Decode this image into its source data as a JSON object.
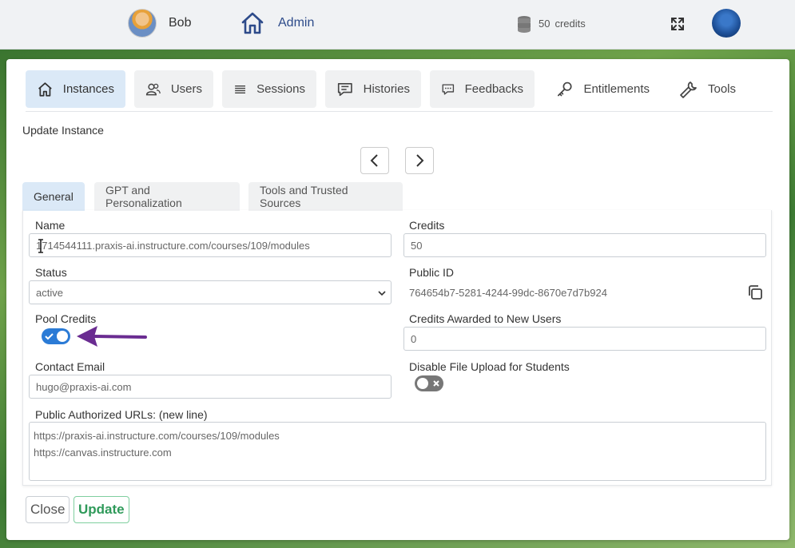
{
  "topbar": {
    "user_name": "Bob",
    "admin_label": "Admin",
    "credits_value": "50",
    "credits_unit": "credits"
  },
  "nav": {
    "tabs": [
      {
        "label": "Instances",
        "icon": "home-icon"
      },
      {
        "label": "Users",
        "icon": "users-icon"
      },
      {
        "label": "Sessions",
        "icon": "list-icon"
      },
      {
        "label": "Histories",
        "icon": "message-icon"
      },
      {
        "label": "Feedbacks",
        "icon": "feedback-icon"
      },
      {
        "label": "Entitlements",
        "icon": "key-icon"
      },
      {
        "label": "Tools",
        "icon": "wrench-icon"
      }
    ]
  },
  "section_title": "Update Instance",
  "subtabs": [
    "General",
    "GPT and Personalization",
    "Tools and Trusted Sources"
  ],
  "form": {
    "name_label": "Name",
    "name_value": "1714544111.praxis-ai.instructure.com/courses/109/modules",
    "credits_label": "Credits",
    "credits_value": "50",
    "status_label": "Status",
    "status_value": "active",
    "public_id_label": "Public ID",
    "public_id_value": "764654b7-5281-4244-99dc-8670e7d7b924",
    "pool_credits_label": "Pool Credits",
    "pool_credits_on": true,
    "credits_awarded_label": "Credits Awarded to New Users",
    "credits_awarded_value": "0",
    "contact_email_label": "Contact Email",
    "contact_email_value": "hugo@praxis-ai.com",
    "disable_upload_label": "Disable File Upload for Students",
    "disable_upload_on": false,
    "urls_label": "Public Authorized URLs: (new line)",
    "urls": [
      "https://praxis-ai.instructure.com/courses/109/modules",
      "https://canvas.instructure.com"
    ]
  },
  "buttons": {
    "close": "Close",
    "update": "Update"
  },
  "colors": {
    "accent_blue": "#2b7bd6",
    "active_tab": "#dbe9f7",
    "update_green": "#2f9a5a",
    "annotation_arrow": "#6a2c91"
  }
}
